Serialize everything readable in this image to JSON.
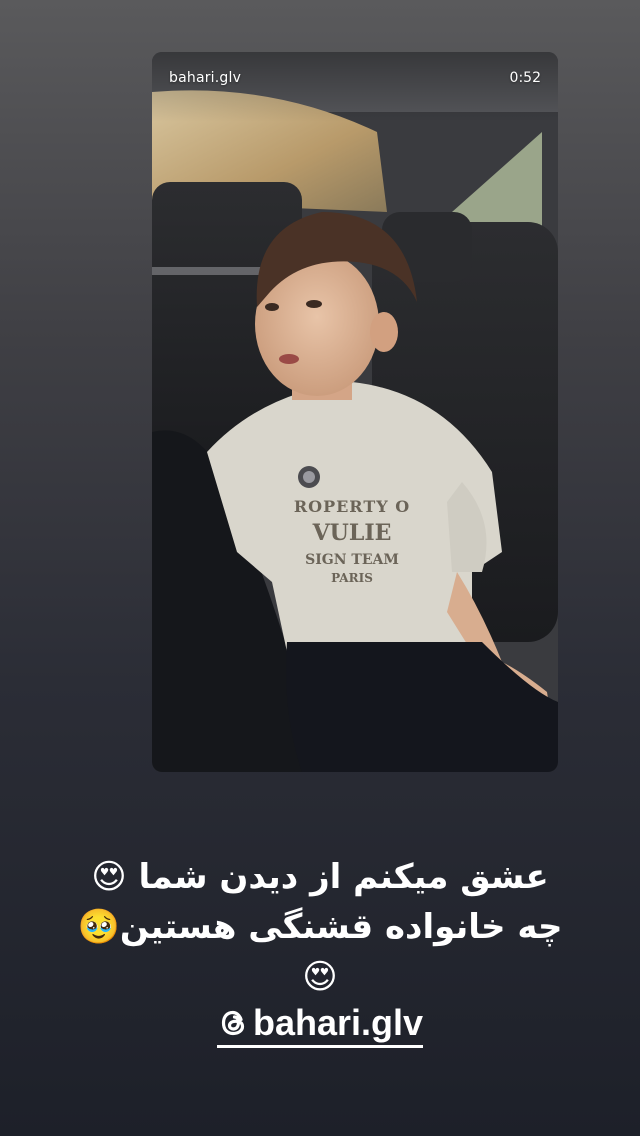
{
  "story": {
    "username": "bahari.glv",
    "duration": "0:52"
  },
  "caption": {
    "line1": "عشق میکنم از دیدن شما 😍",
    "line2": "چه خانواده قشنگی هستین🥹",
    "line3": "😍"
  },
  "mention": {
    "icon": "threads-icon",
    "handle": "bahari.glv"
  },
  "colors": {
    "background_top": "#5a5a5c",
    "background_bottom": "#1d2029",
    "text": "#ffffff"
  }
}
